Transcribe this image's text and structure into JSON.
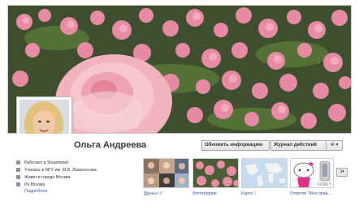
{
  "profile": {
    "name": "Ольга Андреева"
  },
  "actions": {
    "update_info": "Обновить информацию",
    "activity_log": "Журнал действий",
    "gear": "✲ ▾"
  },
  "info": {
    "items": [
      {
        "icon": "briefcase-icon",
        "text": "Работает в Shopmebel"
      },
      {
        "icon": "graduation-cap-icon",
        "text": "Училась в МГУ им. М.В. Ломоносова"
      },
      {
        "icon": "home-icon",
        "text": "Живет в городе Москва"
      },
      {
        "icon": "map-pin-icon",
        "text": "Из Москва"
      }
    ],
    "more": "Подробнее"
  },
  "tiles": {
    "friends": {
      "label": "Друзья",
      "count": "97"
    },
    "photos": {
      "label": "Фотографии"
    },
    "map": {
      "label": "Карта",
      "count": "3"
    },
    "likes": {
      "label": "Отметки \"Мне нрав..."
    },
    "more": "3▾"
  },
  "colors": {
    "link": "#3b5998",
    "cover_pink": "#e58aa0",
    "cover_green": "#3a5a2e"
  }
}
